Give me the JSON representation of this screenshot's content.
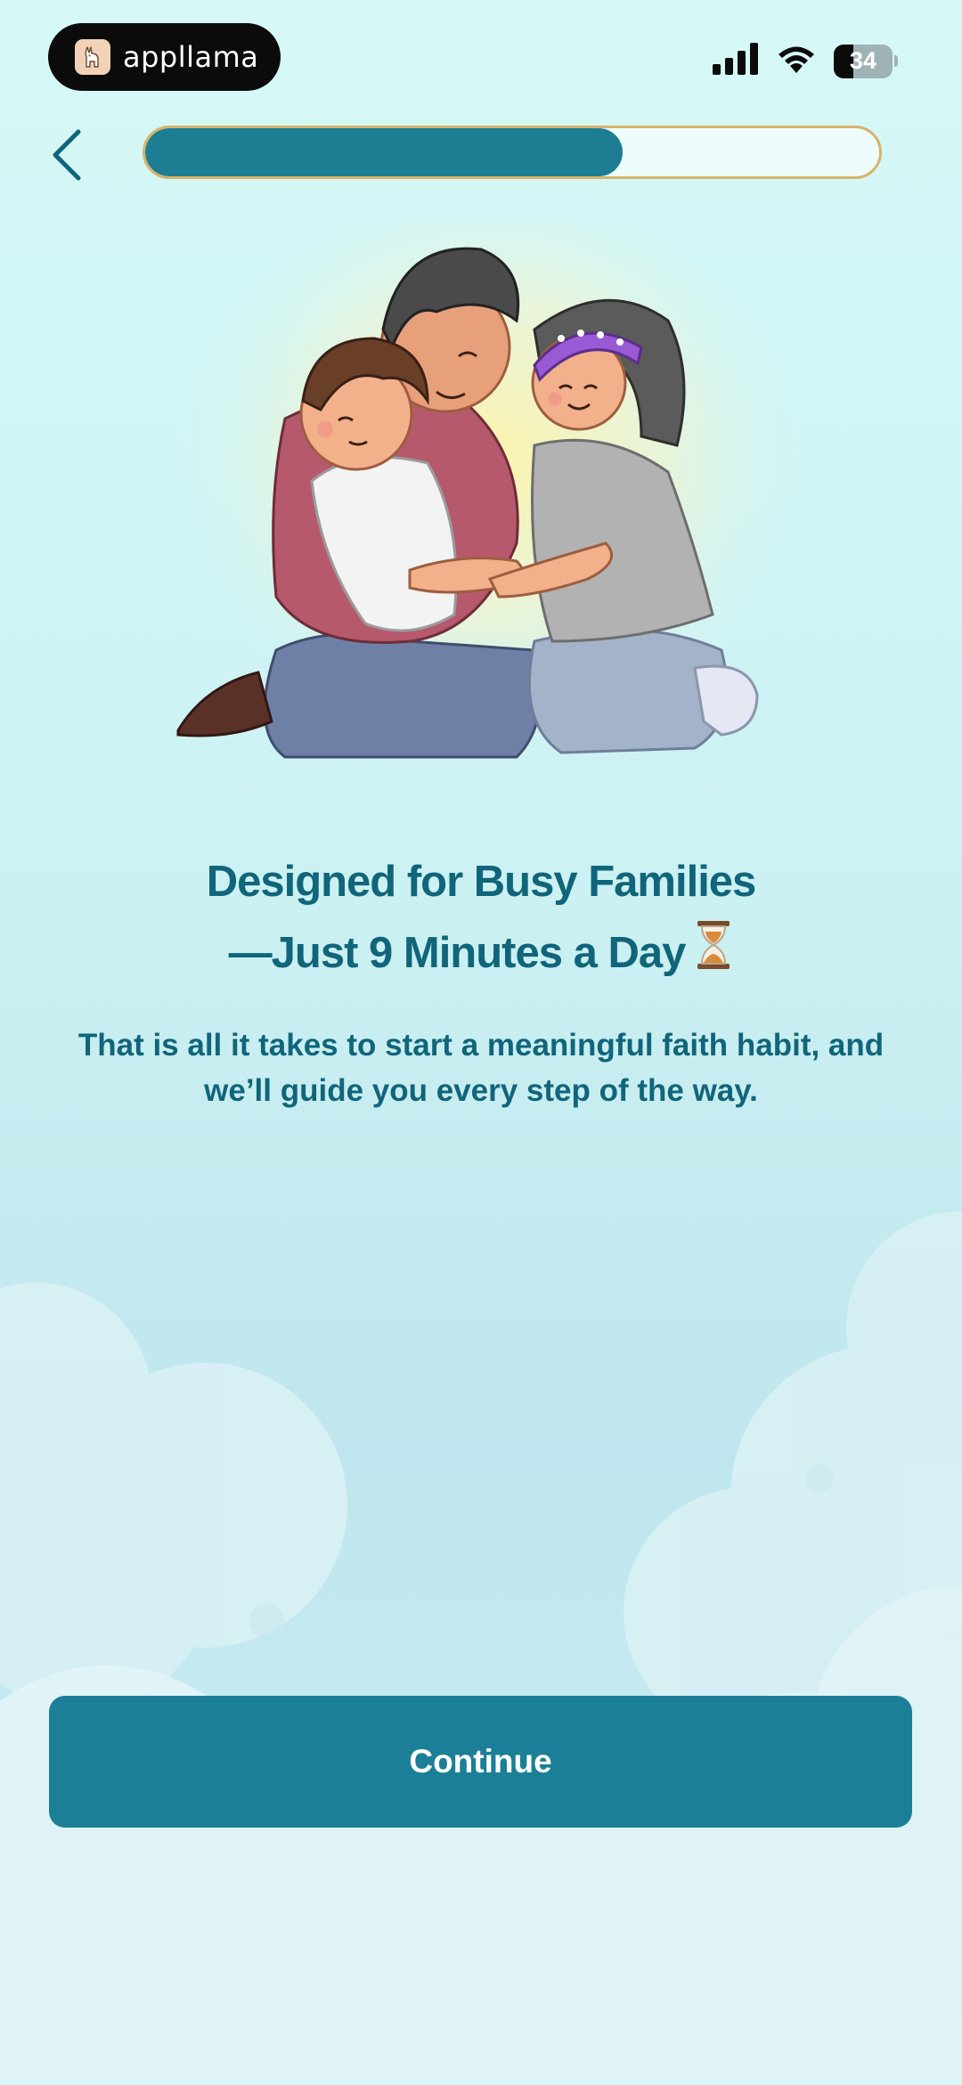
{
  "status_bar": {
    "app_name": "appllama",
    "battery_level": "34",
    "icons": [
      "appllama-logo-icon",
      "cellular-signal-icon",
      "wifi-icon",
      "battery-icon"
    ]
  },
  "header": {
    "back_icon": "chevron-left-icon",
    "progress_fraction": 0.65
  },
  "illustration": {
    "subject": "family-hug-illustration"
  },
  "content": {
    "headline_line1": "Designed for Busy Families",
    "headline_line2": "—Just 9 Minutes a Day",
    "headline_icon": "hourglass-icon",
    "subtext": "That is all it takes to start a meaningful faith habit, and we’ll guide you every step of the way."
  },
  "actions": {
    "continue_label": "Continue"
  },
  "colors": {
    "primary": "#1b7f97",
    "text": "#11657a",
    "progress_border": "#d7b367",
    "background_top": "#d6f8f7"
  }
}
